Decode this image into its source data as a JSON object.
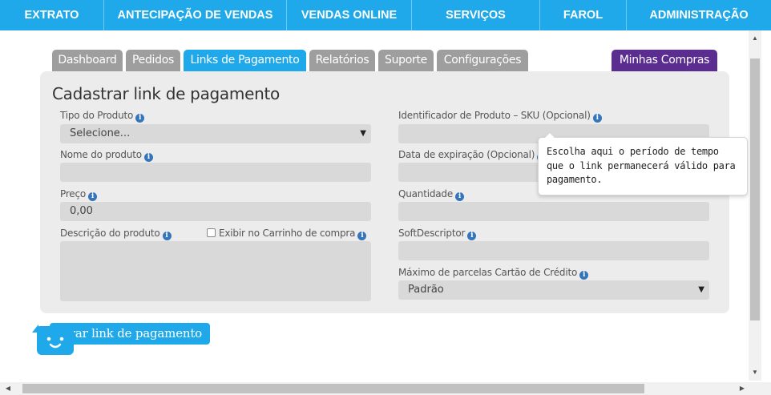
{
  "topnav": {
    "items": [
      "EXTRATO",
      "ANTECIPAÇÃO DE VENDAS",
      "VENDAS ONLINE",
      "SERVIÇOS",
      "FAROL",
      "ADMINISTRAÇÃO"
    ]
  },
  "tabs": {
    "items": [
      "Dashboard",
      "Pedidos",
      "Links de Pagamento",
      "Relatórios",
      "Suporte",
      "Configurações"
    ],
    "active": "Links de Pagamento",
    "right": "Minhas Compras"
  },
  "form": {
    "title": "Cadastrar link de pagamento",
    "tipo_label": "Tipo do Produto",
    "tipo_value": "Selecione...",
    "nome_label": "Nome do produto",
    "nome_value": "",
    "preco_label": "Preço",
    "preco_value": "0,00",
    "descricao_label": "Descrição do produto",
    "exibir_label": "Exibir no Carrinho de compra",
    "sku_label": "Identificador de Produto – SKU (Opcional)",
    "data_label": "Data de expiração (Opcional)",
    "quantidade_label": "Quantidade",
    "soft_label": "SoftDescriptor",
    "parcelas_label": "Máximo de parcelas Cartão de Crédito",
    "parcelas_value": "Padrão"
  },
  "tooltip": {
    "text": "Escolha aqui o período de tempo que o link permanecerá válido para pagamento."
  },
  "actions": {
    "gerar_label": "Gerar link de pagamento"
  },
  "icons": {
    "info": "info-icon",
    "chat": "chat-bot-icon",
    "dropdown": "chevron-down-icon"
  },
  "colors": {
    "primary": "#1fa9ea",
    "tab_inactive": "#9e9e9e",
    "tab_special": "#5b2d91",
    "card_bg": "#ececec",
    "field_bg": "#d9d9d9",
    "info_icon": "#3575bb"
  }
}
